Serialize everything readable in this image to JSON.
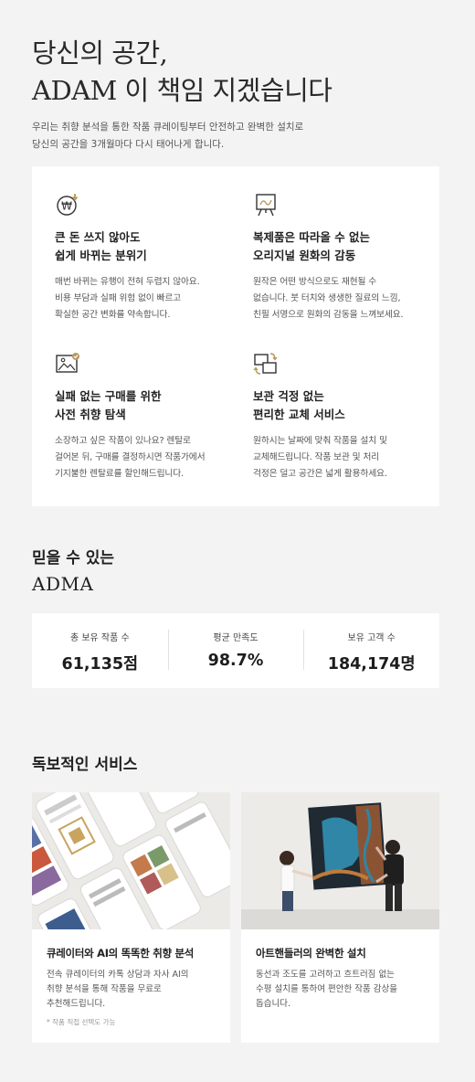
{
  "hero": {
    "title_line1": "당신의 공간,",
    "title_line2": "ADAM 이 책임 지겠습니다",
    "subtitle_line1": "우리는 취향 분석을 통한 작품 큐레이팅부터 안전하고 완벽한 설치로",
    "subtitle_line2": "당신의 공간을 3개월마다 다시 태어나게 합니다."
  },
  "features": [
    {
      "icon": "won-coin-icon",
      "title": "큰 돈 쓰지 않아도\n쉽게 바뀌는 분위기",
      "desc": "매번 바뀌는 유행이 전혀 두렵지 않아요.\n비용 부담과 실패 위험 없이 빠르고\n확실한 공간 변화를 약속합니다."
    },
    {
      "icon": "easel-icon",
      "title": "복제품은 따라올 수 없는\n오리지널 원화의 감동",
      "desc": "원작은 어떤 방식으로도 재현될 수\n없습니다. 붓 터치와 생생한 질료의 느낌,\n친필 서명으로 원화의 감동을 느껴보세요."
    },
    {
      "icon": "picture-check-icon",
      "title": "실패 없는 구매를 위한\n사전 취향 탐색",
      "desc": "소장하고 싶은 작품이 있나요? 렌탈로\n걸어본 뒤, 구매를 결정하시면 작품가에서\n기지불한 렌탈료를 할인해드립니다."
    },
    {
      "icon": "swap-frames-icon",
      "title": "보관 걱정 없는\n편리한 교체 서비스",
      "desc": "원하시는 날짜에 맞춰 작품을 설치 및\n교체해드립니다. 작품 보관 및 처리\n걱정은 덜고 공간은 넓게 활용하세요."
    }
  ],
  "trust": {
    "title": "믿을 수 있는",
    "brand": "ADMA"
  },
  "stats": [
    {
      "label": "총 보유 작품 수",
      "value": "61,135점"
    },
    {
      "label": "평균 만족도",
      "value": "98.7%"
    },
    {
      "label": "보유 고객 수",
      "value": "184,174명"
    }
  ],
  "services": {
    "title": "독보적인 서비스",
    "cards": [
      {
        "image": "app-screens-image",
        "title": "큐레이터와 AI의 똑똑한 취향 분석",
        "desc": "전속 큐레이터의 카톡 상담과 자사 AI의\n취향 분석을 통해 작품을 무료로\n추천해드립니다.",
        "note": "* 작품 직접 선택도 가능"
      },
      {
        "image": "art-installation-photo",
        "title": "아트핸들러의 완벽한 설치",
        "desc": "동선과 조도를 고려하고 흐트러짐 없는\n수평 설치를 통하여 편안한 작품 감상을\n돕습니다."
      }
    ]
  },
  "colors": {
    "background": "#f3f3f3",
    "card": "#ffffff",
    "icon_accent": "#b89a5e",
    "text": "#222222"
  }
}
